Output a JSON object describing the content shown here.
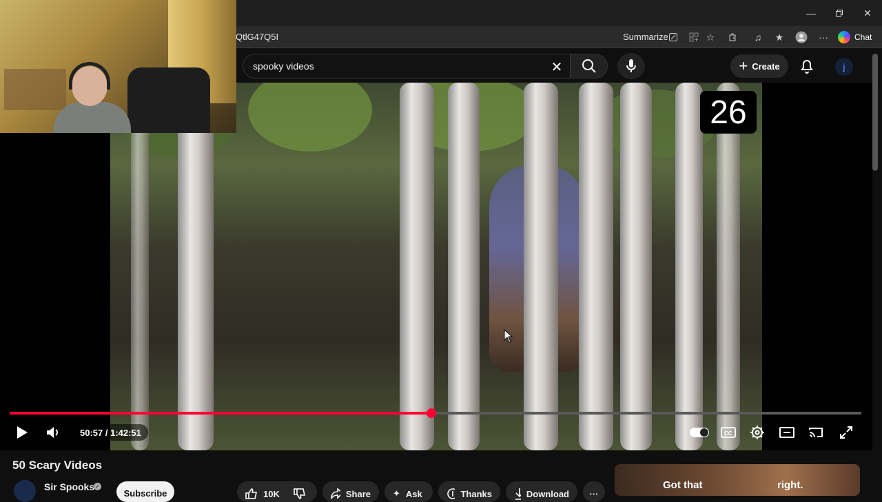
{
  "browser": {
    "url_fragment": "QtlG47Q5I",
    "summarize_label": "Summarize",
    "chat_label": "Chat",
    "window_controls": [
      "minimize-icon",
      "restore-icon",
      "close-icon"
    ]
  },
  "youtube": {
    "search": {
      "value": "spooky videos"
    },
    "create_label": "Create",
    "avatar_letter": "j"
  },
  "player": {
    "counter": "26",
    "time_display": "50:57 / 1:42:51",
    "progress_fraction": 0.495,
    "accent": "#ff0033"
  },
  "video": {
    "title": "50 Scary Videos",
    "channel": "Sir Spooks",
    "subscribe_label": "Subscribe",
    "likes": "10K",
    "share_label": "Share",
    "ask_label": "Ask",
    "thanks_label": "Thanks",
    "download_label": "Download"
  },
  "ad": {
    "text_a": "Got that",
    "text_b": "right."
  }
}
